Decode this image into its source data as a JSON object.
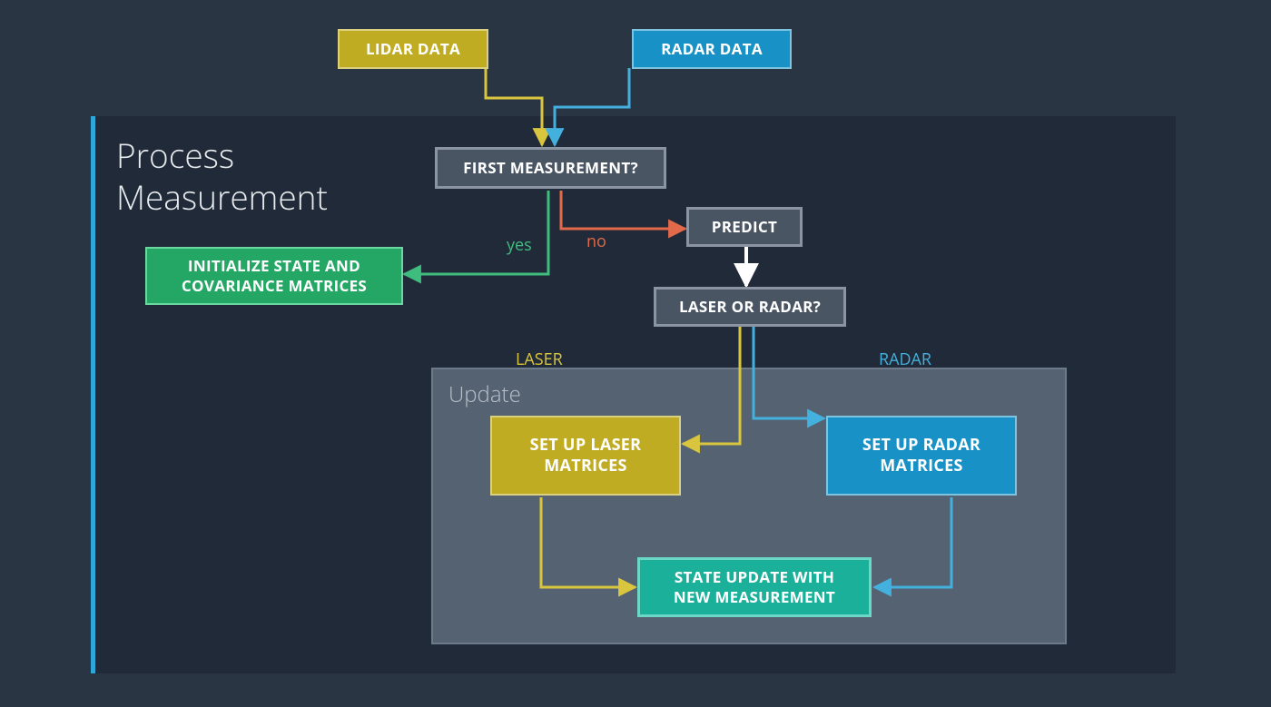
{
  "title": "Process\nMeasurement",
  "update_title": "Update",
  "nodes": {
    "lidar": "LIDAR DATA",
    "radar": "RADAR DATA",
    "first": "FIRST MEASUREMENT?",
    "init": "INITIALIZE STATE AND COVARIANCE MATRICES",
    "predict": "PREDICT",
    "laser_or_radar": "LASER OR RADAR?",
    "setup_laser": "SET UP LASER MATRICES",
    "setup_radar": "SET UP RADAR MATRICES",
    "state_update": "STATE UPDATE WITH NEW MEASUREMENT"
  },
  "labels": {
    "yes": "yes",
    "no": "no",
    "laser": "LASER",
    "radar": "RADAR"
  },
  "colors": {
    "yellow": "#c0ac23",
    "blue": "#1892c6",
    "gray": "#4a5564",
    "green": "#24a764",
    "teal": "#1bb09a",
    "red": "#e26a4a",
    "accent_line": "#2ca7d8",
    "panel_bg": "#212a38",
    "page_bg": "#2a3544",
    "update_bg": "#556272"
  }
}
